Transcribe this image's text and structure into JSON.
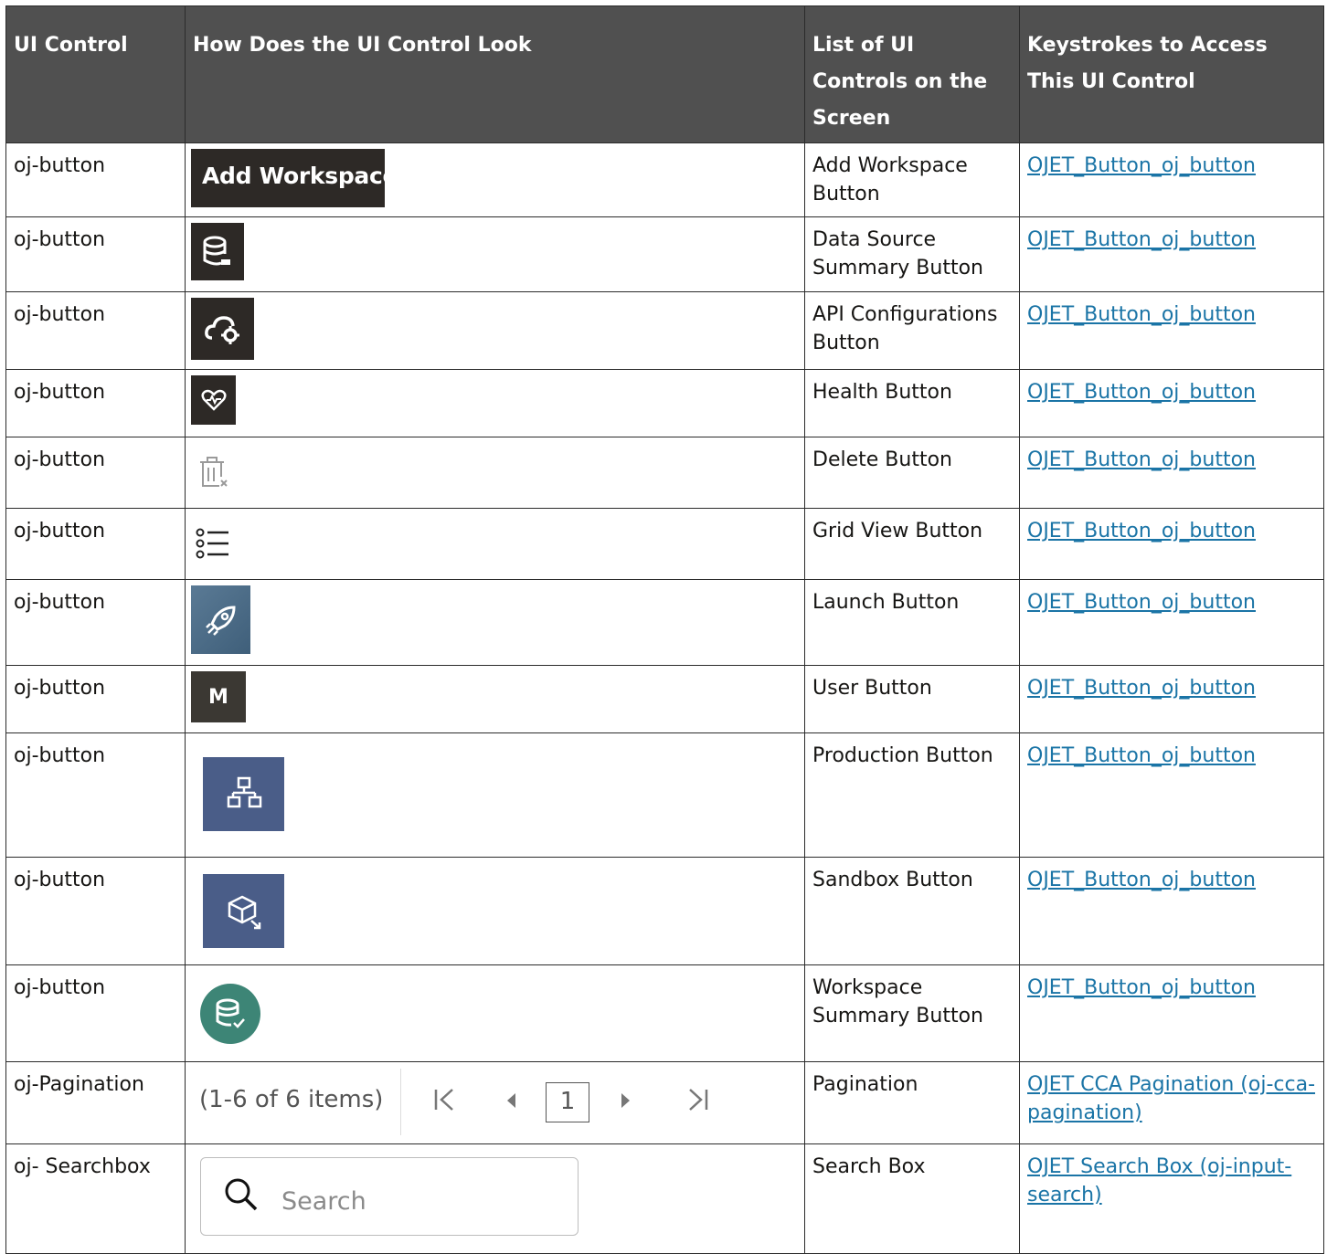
{
  "headers": {
    "col1": "UI Control",
    "col2": "How Does the UI Control Look",
    "col3": "List of UI Controls on the Screen",
    "col4": "Keystrokes to Access This UI Control"
  },
  "rows": [
    {
      "control": "oj-button",
      "preview_label": "Add Workspace",
      "name": "Add Workspace Button",
      "link": "OJET_Button_oj_button"
    },
    {
      "control": "oj-button",
      "icon": "database-icon",
      "name": "Data Source Summary Button",
      "link": "OJET_Button_oj_button"
    },
    {
      "control": "oj-button",
      "icon": "cloud-gear-icon",
      "name": "API Configurations Button",
      "link": "OJET_Button_oj_button"
    },
    {
      "control": "oj-button",
      "icon": "heart-pulse-icon",
      "name": "Health Button",
      "link": "OJET_Button_oj_button"
    },
    {
      "control": "oj-button",
      "icon": "trash-icon",
      "name": "Delete Button",
      "link": "OJET_Button_oj_button"
    },
    {
      "control": "oj-button",
      "icon": "list-icon",
      "name": "Grid View Button",
      "link": "OJET_Button_oj_button"
    },
    {
      "control": "oj-button",
      "icon": "rocket-icon",
      "name": "Launch Button",
      "link": "OJET_Button_oj_button"
    },
    {
      "control": "oj-button",
      "preview_label": "M",
      "name": "User Button",
      "link": "OJET_Button_oj_button"
    },
    {
      "control": "oj-button",
      "icon": "hierarchy-icon",
      "name": "Production Button",
      "link": "OJET_Button_oj_button"
    },
    {
      "control": "oj-button",
      "icon": "cube-icon",
      "name": "Sandbox Button",
      "link": "OJET_Button_oj_button"
    },
    {
      "control": "oj-button",
      "icon": "database-check-icon",
      "name": "Workspace Summary Button",
      "link": "OJET_Button_oj_button"
    },
    {
      "control": "oj-Pagination",
      "preview_label": "(1-6 of 6 items)",
      "page": "1",
      "name": "Pagination",
      "link": "OJET CCA Pagination (oj-cca-pagination)"
    },
    {
      "control": "oj- Searchbox",
      "preview_label": "Search",
      "name": "Search Box",
      "link": "OJET Search Box (oj-input-search)"
    }
  ],
  "colors": {
    "header_bg": "#505050",
    "link": "#1a74a6",
    "dark_tile": "#2d2926",
    "blue_tile": "#4a5d88",
    "teal": "#3d8576"
  }
}
